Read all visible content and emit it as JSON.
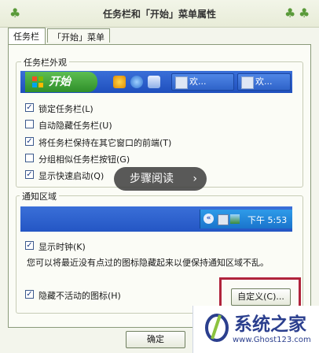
{
  "window": {
    "title": "任务栏和「开始」菜单属性"
  },
  "tabs": [
    {
      "label": "任务栏",
      "active": true
    },
    {
      "label": "「开始」菜单",
      "active": false
    }
  ],
  "taskbar_appearance": {
    "legend": "任务栏外观",
    "start_label": "开始",
    "task_buttons": [
      "欢...",
      "欢..."
    ],
    "options": [
      {
        "label": "锁定任务栏(L)",
        "checked": true
      },
      {
        "label": "自动隐藏任务栏(U)",
        "checked": false
      },
      {
        "label": "将任务栏保持在其它窗口的前端(T)",
        "checked": true
      },
      {
        "label": "分组相似任务栏按钮(G)",
        "checked": false
      },
      {
        "label": "显示快速启动(Q)",
        "checked": true
      }
    ]
  },
  "overlay": {
    "label": "步骤阅读",
    "chevron": "›"
  },
  "notification_area": {
    "legend": "通知区域",
    "tray_chevron": "«",
    "clock": "下午 5:53",
    "show_clock": {
      "label": "显示时钟(K)",
      "checked": true
    },
    "description": "您可以将最近没有点过的图标隐藏起来以便保持通知区域不乱。",
    "hide_inactive": {
      "label": "隐藏不活动的图标(H)",
      "checked": true
    },
    "customize_label": "自定义(C)..."
  },
  "footer": {
    "ok_label": "确定"
  },
  "watermark": {
    "brand": "系统之家",
    "url": "www.Ghost123.com"
  },
  "colors": {
    "accent_red": "#b0243c",
    "taskbar_blue": "#2456c4",
    "start_green": "#3a9a33"
  }
}
